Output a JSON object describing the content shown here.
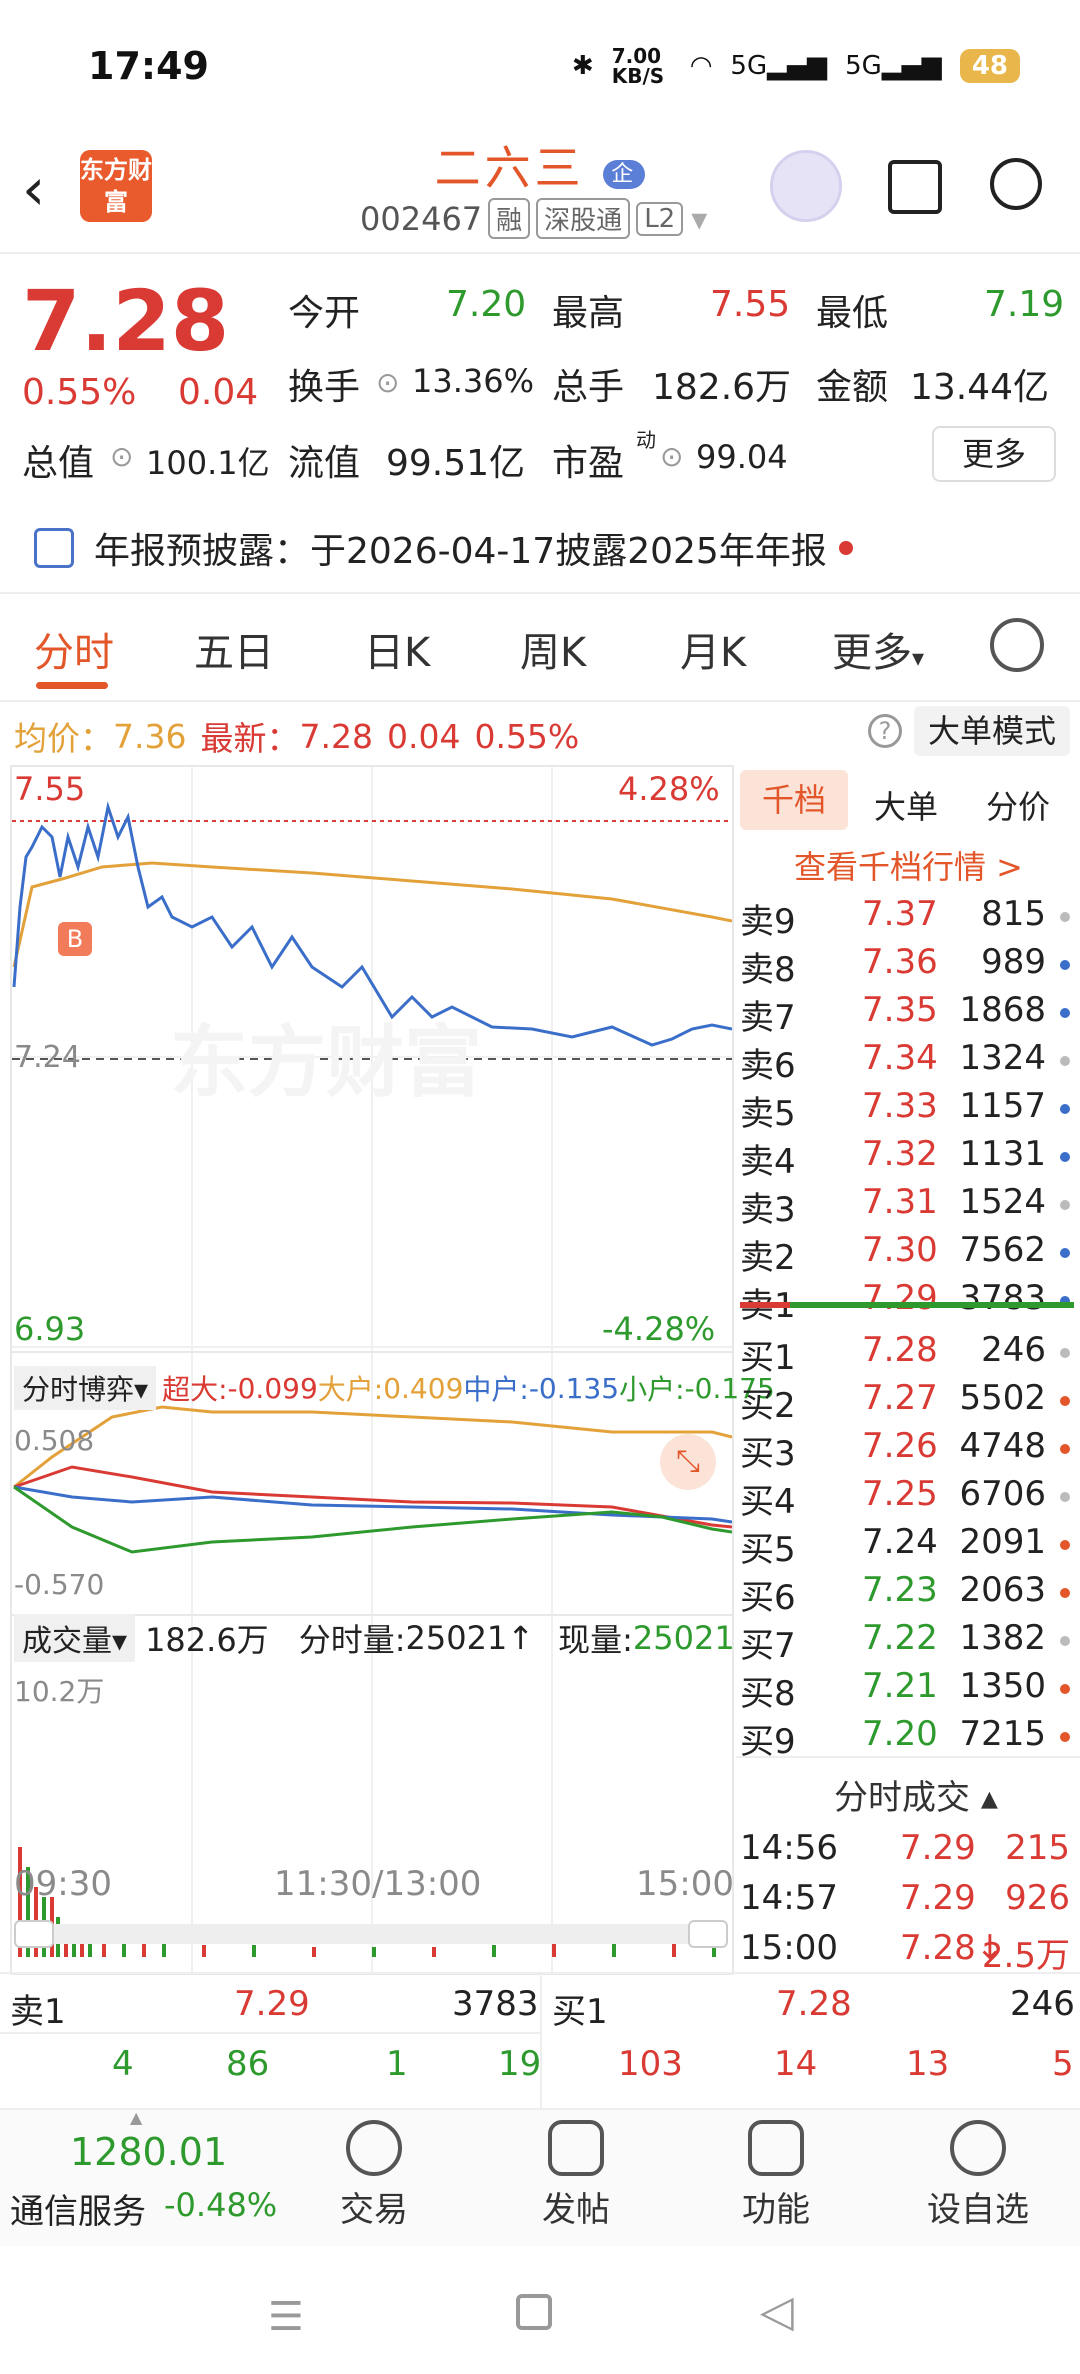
{
  "status": {
    "time": "17:49",
    "net_speed": "7.00 KB/S",
    "signal1": "5G",
    "signal2": "5G",
    "battery": "48"
  },
  "header": {
    "logo": "东方财富",
    "title": "二六三",
    "badge": "企",
    "code": "002467",
    "tags": [
      "融",
      "深股通",
      "L2"
    ]
  },
  "quote": {
    "price": "7.28",
    "pct": "0.55%",
    "chg": "0.04",
    "open_label": "今开",
    "open": "7.20",
    "high_label": "最高",
    "high": "7.55",
    "low_label": "最低",
    "low": "7.19",
    "turnover_label": "换手",
    "turnover": "13.36%",
    "vol_label": "总手",
    "vol": "182.6万",
    "amount_label": "金额",
    "amount": "13.44亿",
    "cap_label": "总值",
    "cap": "100.1亿",
    "float_label": "流值",
    "float_cap": "99.51亿",
    "pe_label": "市盈",
    "pe_sup": "动",
    "pe": "99.04",
    "more_button": "更多"
  },
  "notice": {
    "text": "年报预披露：于2026-04-17披露2025年年报"
  },
  "tabs": [
    "分时",
    "五日",
    "日K",
    "周K",
    "月K",
    "更多"
  ],
  "infoline": {
    "avg_label": "均价：",
    "avg": "7.36",
    "latest_label": "最新：",
    "latest": "7.28",
    "chg": "0.04",
    "pct": "0.55%",
    "mode_button": "大单模式"
  },
  "chart": {
    "top_price": "7.55",
    "top_pct": "4.28%",
    "mid_price": "7.24",
    "bot_price": "6.93",
    "bot_pct": "-4.28%",
    "b_marker": "B",
    "watermark": "东方财富",
    "flow_selector": "分时博弈",
    "flow": {
      "super_label": "超大:",
      "super": "-0.099",
      "big_label": "大户:",
      "big": "0.409",
      "mid_label": "中户:",
      "mid": "-0.135",
      "small_label": "小户:",
      "small": "-0.175"
    },
    "flow_top": "0.508",
    "flow_bot": "-0.570",
    "vol_selector": "成交量",
    "vol_total": "182.6万",
    "tick_vol_label": "分时量:",
    "tick_vol": "25021",
    "now_vol_label": "现量:",
    "now_vol": "25021",
    "vol_max": "10.2万",
    "times": [
      "09:30",
      "11:30/13:00",
      "15:00"
    ]
  },
  "orderbook": {
    "tabs": [
      "千档",
      "大单",
      "分价"
    ],
    "link": "查看千档行情 >",
    "asks": [
      [
        "卖9",
        "7.37",
        "815"
      ],
      [
        "卖8",
        "7.36",
        "989"
      ],
      [
        "卖7",
        "7.35",
        "1868"
      ],
      [
        "卖6",
        "7.34",
        "1324"
      ],
      [
        "卖5",
        "7.33",
        "1157"
      ],
      [
        "卖4",
        "7.32",
        "1131"
      ],
      [
        "卖3",
        "7.31",
        "1524"
      ],
      [
        "卖2",
        "7.30",
        "7562"
      ],
      [
        "卖1",
        "7.29",
        "3783"
      ]
    ],
    "bids": [
      [
        "买1",
        "7.28",
        "246"
      ],
      [
        "买2",
        "7.27",
        "5502"
      ],
      [
        "买3",
        "7.26",
        "4748"
      ],
      [
        "买4",
        "7.25",
        "6706"
      ],
      [
        "买5",
        "7.24",
        "2091"
      ],
      [
        "买6",
        "7.23",
        "2063"
      ],
      [
        "买7",
        "7.22",
        "1382"
      ],
      [
        "买8",
        "7.21",
        "1350"
      ],
      [
        "买9",
        "7.20",
        "7215"
      ]
    ],
    "trades_title": "分时成交",
    "trades": [
      [
        "14:56",
        "7.29",
        "215"
      ],
      [
        "14:57",
        "7.29",
        "926"
      ],
      [
        "15:00",
        "7.28↓",
        "2.5万"
      ]
    ]
  },
  "bottom_quote": {
    "sell_label": "卖1",
    "sell_price": "7.29",
    "sell_vol": "3783",
    "buy_label": "买1",
    "buy_price": "7.28",
    "buy_vol": "246",
    "queue_sell": [
      "4",
      "86",
      "1",
      "19"
    ],
    "queue_buy": [
      "103",
      "14",
      "13",
      "5"
    ]
  },
  "nav": {
    "index_value": "1280.01",
    "index_name": "通信服务",
    "index_pct": "-0.48%",
    "items": [
      "交易",
      "发帖",
      "功能",
      "设自选"
    ]
  }
}
